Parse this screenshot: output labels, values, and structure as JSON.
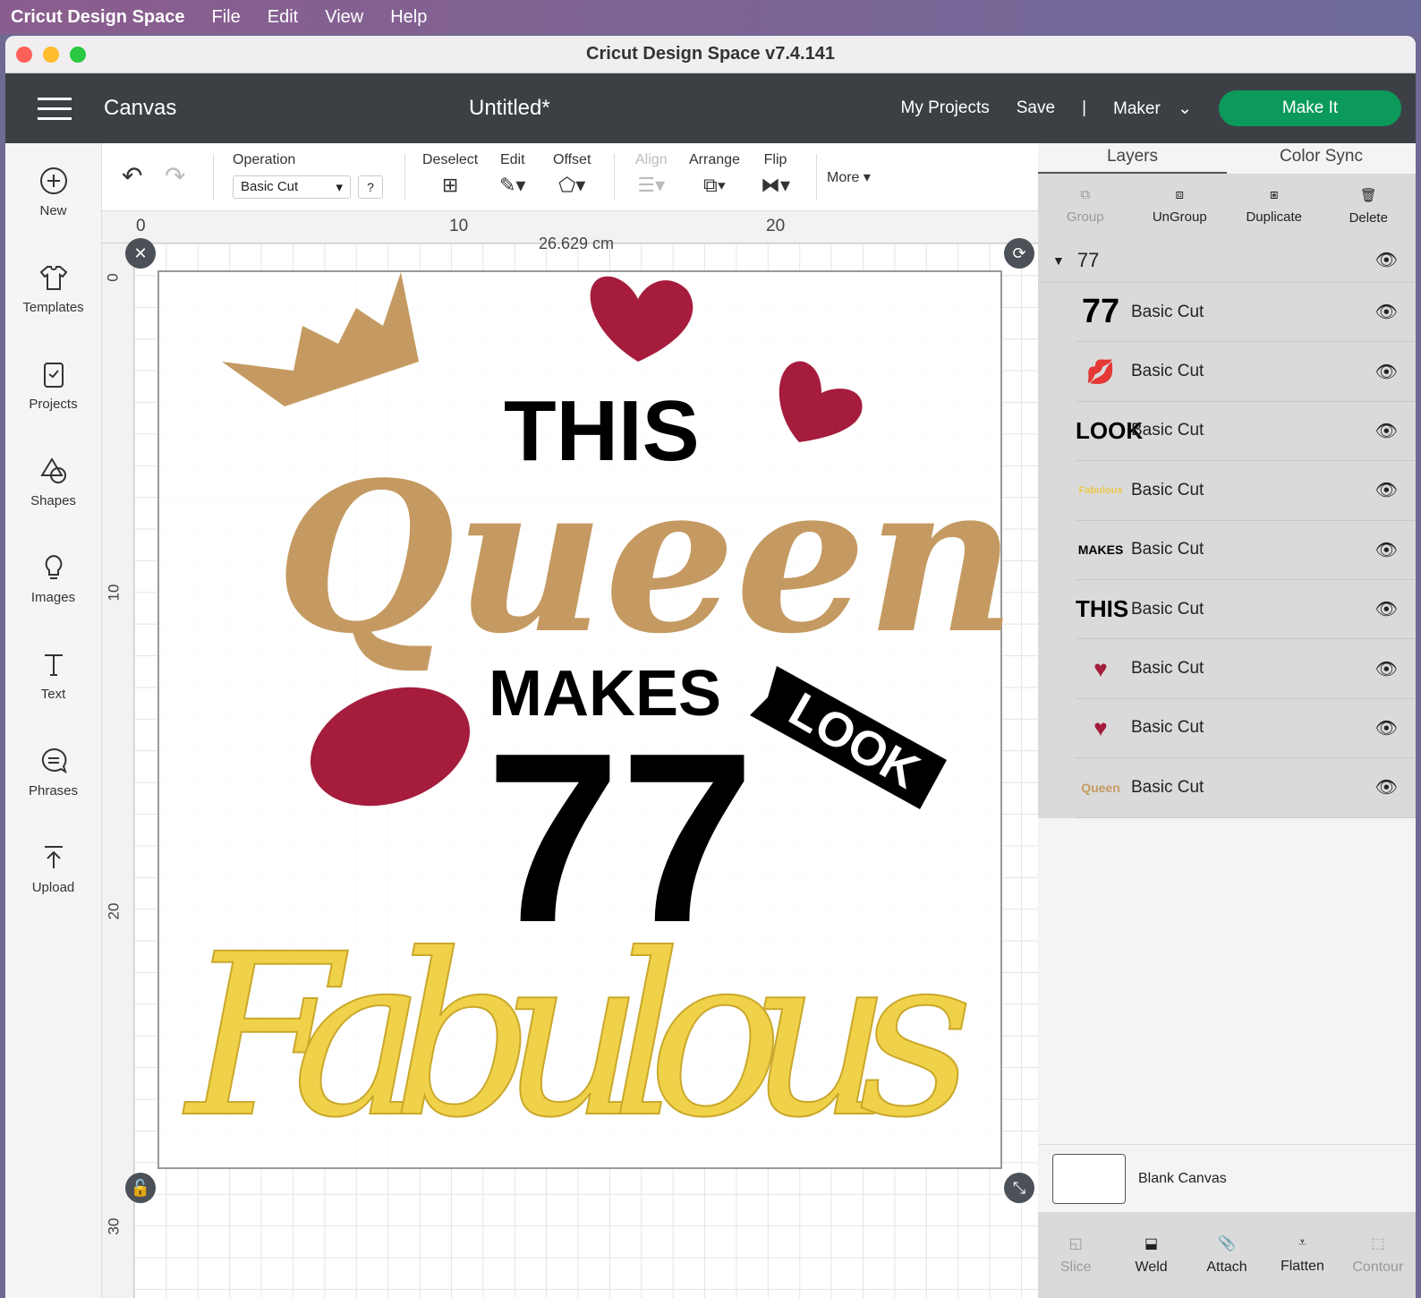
{
  "menubar": {
    "app": "Cricut Design Space",
    "items": [
      "File",
      "Edit",
      "View",
      "Help"
    ]
  },
  "window": {
    "title": "Cricut Design Space  v7.4.141"
  },
  "header": {
    "section": "Canvas",
    "doc_title": "Untitled*",
    "my_projects": "My Projects",
    "save": "Save",
    "divider": "|",
    "machine": "Maker",
    "make_it": "Make It",
    "accent": "#0b9a5b"
  },
  "sidebar": [
    "New",
    "Templates",
    "Projects",
    "Shapes",
    "Images",
    "Text",
    "Phrases",
    "Upload"
  ],
  "toolbar": {
    "operation_label": "Operation",
    "operation_value": "Basic Cut",
    "help": "?",
    "deselect": "Deselect",
    "edit": "Edit",
    "offset": "Offset",
    "align": "Align",
    "arrange": "Arrange",
    "flip": "Flip",
    "more": "More ▾"
  },
  "ruler": {
    "top": [
      "0",
      "10",
      "20"
    ],
    "left": [
      "0",
      "10",
      "20",
      "30"
    ]
  },
  "canvas": {
    "dimension": "26.629 cm"
  },
  "design": {
    "this": "THIS",
    "queen": "Queen",
    "makes": "MAKES",
    "number": "77",
    "look": "LOOK",
    "fabulous": "Fabulous"
  },
  "panel": {
    "tabs": [
      "Layers",
      "Color Sync"
    ],
    "actions": [
      "Group",
      "UnGroup",
      "Duplicate",
      "Delete"
    ],
    "group_name": "77",
    "layers": [
      {
        "thumb": "77",
        "label": "Basic Cut",
        "color": "#000"
      },
      {
        "thumb": "💋",
        "label": "Basic Cut",
        "color": "#a51c3c"
      },
      {
        "thumb": "LOOK",
        "label": "Basic Cut",
        "color": "#000"
      },
      {
        "thumb": "Fabulous",
        "label": "Basic Cut",
        "color": "#e9c84a"
      },
      {
        "thumb": "MAKES",
        "label": "Basic Cut",
        "color": "#000"
      },
      {
        "thumb": "THIS",
        "label": "Basic Cut",
        "color": "#000"
      },
      {
        "thumb": "♥",
        "label": "Basic Cut",
        "color": "#a51c3c"
      },
      {
        "thumb": "♥",
        "label": "Basic Cut",
        "color": "#a51c3c"
      },
      {
        "thumb": "Queen",
        "label": "Basic Cut",
        "color": "#c49a62"
      }
    ],
    "blank_canvas": "Blank Canvas",
    "bottom": [
      "Slice",
      "Weld",
      "Attach",
      "Flatten",
      "Contour"
    ]
  }
}
